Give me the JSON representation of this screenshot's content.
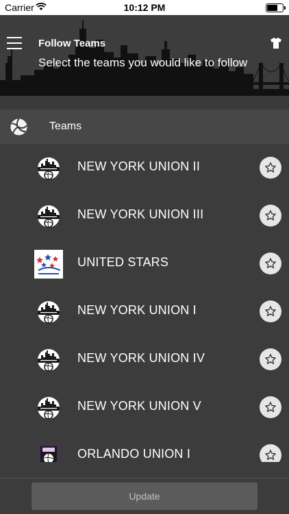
{
  "status_bar": {
    "carrier": "Carrier",
    "time": "10:12 PM"
  },
  "header": {
    "title": "Follow Teams",
    "subtitle": "Select the teams you would like to follow",
    "menu_icon": "hamburger-menu-icon",
    "right_icon": "jersey-icon"
  },
  "section": {
    "label": "Teams",
    "icon": "volleyball-icon"
  },
  "teams": [
    {
      "name": "NEW YORK UNION II",
      "logo": "new-york-union"
    },
    {
      "name": "NEW YORK UNION III",
      "logo": "new-york-union"
    },
    {
      "name": "UNITED STARS",
      "logo": "united-stars"
    },
    {
      "name": "NEW YORK UNION I",
      "logo": "new-york-union"
    },
    {
      "name": "NEW YORK UNION IV",
      "logo": "new-york-union"
    },
    {
      "name": "NEW YORK UNION V",
      "logo": "new-york-union"
    },
    {
      "name": "ORLANDO UNION I",
      "logo": "orlando-union"
    }
  ],
  "footer": {
    "update_label": "Update"
  },
  "colors": {
    "background": "#3c3c3c",
    "section_bg": "#474747",
    "star_button": "#e6e6e6"
  }
}
